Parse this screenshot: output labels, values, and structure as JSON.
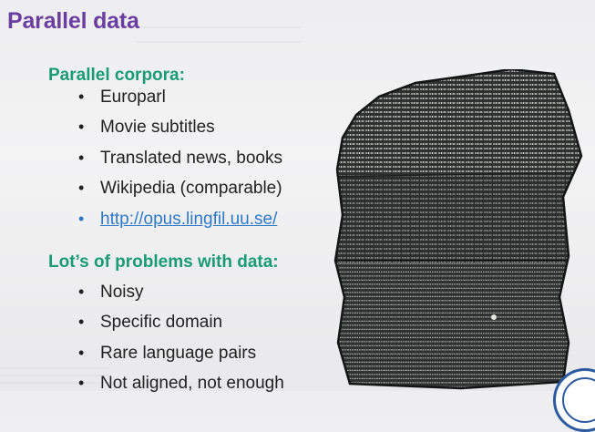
{
  "slide": {
    "title": "Parallel data",
    "sections": [
      {
        "heading": "Parallel corpora:",
        "items": [
          {
            "text": "Europarl",
            "is_link": false
          },
          {
            "text": "Movie subtitles",
            "is_link": false
          },
          {
            "text": "Translated news, books",
            "is_link": false
          },
          {
            "text": "Wikipedia (comparable)",
            "is_link": false
          },
          {
            "text": "http://opus.lingfil.uu.se/",
            "is_link": true
          }
        ]
      },
      {
        "heading": "Lot’s of problems with data:",
        "items": [
          {
            "text": "Noisy",
            "is_link": false
          },
          {
            "text": "Specific domain",
            "is_link": false
          },
          {
            "text": "Rare language pairs",
            "is_link": false
          },
          {
            "text": "Not aligned, not enough",
            "is_link": false
          }
        ]
      }
    ]
  },
  "colors": {
    "title": "#6a3ea0",
    "heading": "#1a9c72",
    "body_text": "#222222",
    "link": "#2f78c8",
    "stone": "#2f3130"
  },
  "image": {
    "icon": "rosetta-stone-image"
  }
}
